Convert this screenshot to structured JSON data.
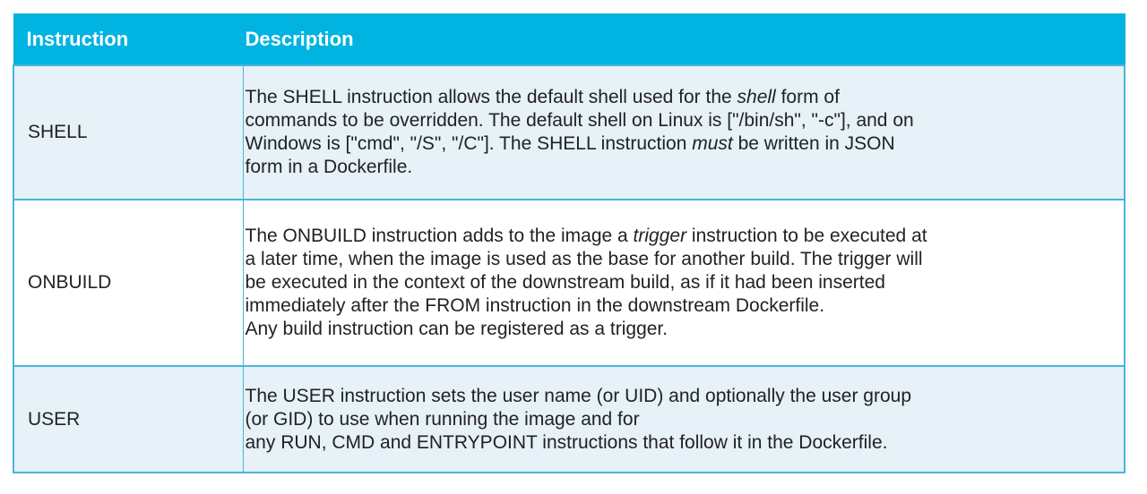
{
  "table": {
    "headers": {
      "instruction": "Instruction",
      "description": "Description"
    },
    "rows": [
      {
        "instruction": "SHELL",
        "lines": [
          [
            {
              "t": "The SHELL instruction allows the default shell used for the "
            },
            {
              "t": "shell",
              "i": true
            },
            {
              "t": " form of"
            }
          ],
          [
            {
              "t": "commands to be overridden. The default shell on Linux is [\"/bin/sh\", \"-c\"], and on"
            }
          ],
          [
            {
              "t": "Windows is [\"cmd\", \"/S\", \"/C\"]. The SHELL instruction "
            },
            {
              "t": "must",
              "i": true
            },
            {
              "t": " be written in JSON"
            }
          ],
          [
            {
              "t": "form in a Dockerfile."
            }
          ]
        ]
      },
      {
        "instruction": "ONBUILD",
        "lines": [
          [
            {
              "t": "The ONBUILD instruction adds to the image a "
            },
            {
              "t": "trigger",
              "i": true
            },
            {
              "t": " instruction to be executed at"
            }
          ],
          [
            {
              "t": "a later time, when the image is used as the base for another build. The trigger will"
            }
          ],
          [
            {
              "t": "be executed in the context of the downstream build, as if it had been inserted"
            }
          ],
          [
            {
              "t": "immediately after the FROM instruction in the downstream Dockerfile."
            }
          ],
          [
            {
              "t": "Any build instruction can be registered as a trigger."
            }
          ]
        ]
      },
      {
        "instruction": "USER",
        "lines": [
          [
            {
              "t": "The USER instruction sets the user name (or UID) and optionally the user group"
            }
          ],
          [
            {
              "t": "(or GID) to use when running the image and for"
            }
          ],
          [
            {
              "t": "any RUN, CMD and ENTRYPOINT instructions that follow it in the Dockerfile."
            }
          ]
        ]
      }
    ]
  }
}
